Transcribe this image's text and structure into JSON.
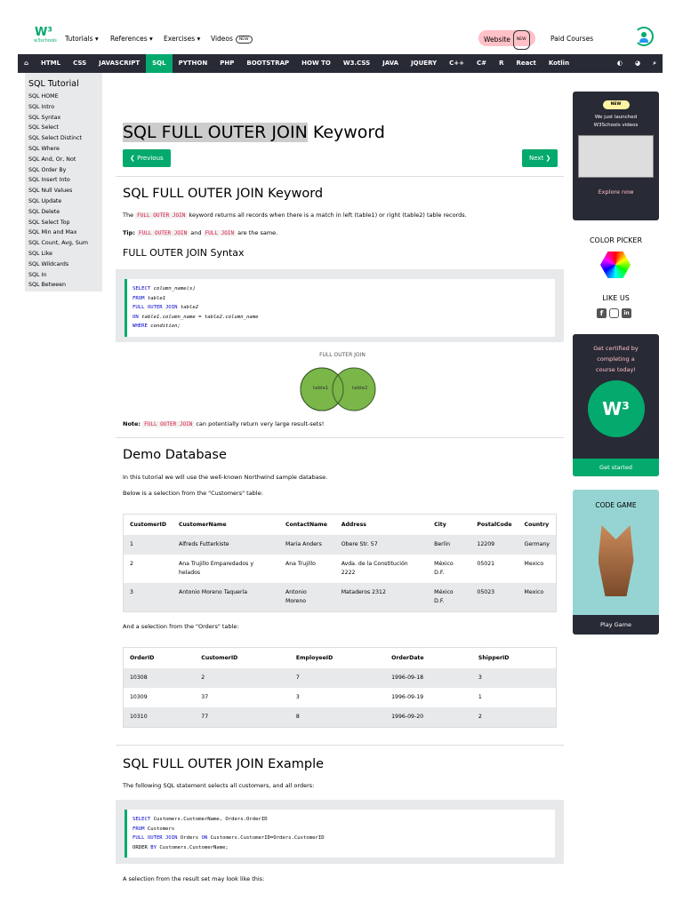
{
  "header": {
    "logo": "w3schools",
    "menu": [
      "Tutorials ▾",
      "References ▾",
      "Exercises ▾",
      "Videos"
    ],
    "new_badge": "NEW",
    "website": "Website",
    "paid_courses": "Paid Courses"
  },
  "nav": {
    "items": [
      "HTML",
      "CSS",
      "JAVASCRIPT",
      "SQL",
      "PYTHON",
      "PHP",
      "BOOTSTRAP",
      "HOW TO",
      "W3.CSS",
      "JAVA",
      "JQUERY",
      "C++",
      "C#",
      "R",
      "React",
      "Kotlin"
    ],
    "active": "SQL"
  },
  "left_sidebar": {
    "title": "SQL Tutorial",
    "items": [
      "SQL HOME",
      "SQL Intro",
      "SQL Syntax",
      "SQL Select",
      "SQL Select Distinct",
      "SQL Where",
      "SQL And, Or, Not",
      "SQL Order By",
      "SQL Insert Into",
      "SQL Null Values",
      "SQL Update",
      "SQL Delete",
      "SQL Select Top",
      "SQL Min and Max",
      "SQL Count, Avg, Sum",
      "SQL Like",
      "SQL Wildcards",
      "SQL In",
      "SQL Between"
    ]
  },
  "main": {
    "title_hl": "SQL FULL OUTER JOIN",
    "title_rest": " Keyword",
    "prev": "❮ Previous",
    "next": "Next ❯",
    "h2": "SQL FULL OUTER JOIN Keyword",
    "p1_a": "The ",
    "p1_kw": "FULL OUTER JOIN",
    "p1_b": " keyword returns all records when there is a match in left (table1) or right (table2) table records.",
    "tip_label": "Tip:",
    "tip_kw1": "FULL OUTER JOIN",
    "tip_and": " and ",
    "tip_kw2": "FULL JOIN",
    "tip_end": " are the same.",
    "syntax_h": "FULL OUTER JOIN Syntax",
    "syntax": [
      [
        "SELECT",
        " column_name(s)"
      ],
      [
        "FROM",
        " table1"
      ],
      [
        "FULL OUTER JOIN",
        " table2"
      ],
      [
        "ON",
        " table1.column_name = table2.column_name"
      ],
      [
        "WHERE",
        " condition;"
      ]
    ],
    "venn": {
      "title": "FULL OUTER JOIN",
      "left": "table1",
      "right": "table2"
    },
    "note_label": "Note:",
    "note_kw": "FULL OUTER JOIN",
    "note_text": " can potentially return very large result-sets!",
    "demo_h": "Demo Database",
    "demo_p1": "In this tutorial we will use the well-known Northwind sample database.",
    "demo_p2": "Below is a selection from the \"Customers\" table:",
    "customers": {
      "headers": [
        "CustomerID",
        "CustomerName",
        "ContactName",
        "Address",
        "City",
        "PostalCode",
        "Country"
      ],
      "rows": [
        [
          "1",
          "Alfreds Futterkiste",
          "Maria Anders",
          "Obere Str. 57",
          "Berlin",
          "12209",
          "Germany"
        ],
        [
          "2",
          "Ana Trujillo Emparedados y helados",
          "Ana Trujillo",
          "Avda. de la Constitución 2222",
          "México D.F.",
          "05021",
          "Mexico"
        ],
        [
          "3",
          "Antonio Moreno Taquería",
          "Antonio Moreno",
          "Mataderos 2312",
          "México D.F.",
          "05023",
          "Mexico"
        ]
      ]
    },
    "orders_p": "And a selection from the \"Orders\" table:",
    "orders": {
      "headers": [
        "OrderID",
        "CustomerID",
        "EmployeeID",
        "OrderDate",
        "ShipperID"
      ],
      "rows": [
        [
          "10308",
          "2",
          "7",
          "1996-09-18",
          "3"
        ],
        [
          "10309",
          "37",
          "3",
          "1996-09-19",
          "1"
        ],
        [
          "10310",
          "77",
          "8",
          "1996-09-20",
          "2"
        ]
      ]
    },
    "example_h": "SQL FULL OUTER JOIN Example",
    "example_p": "The following SQL statement selects all customers, and all orders:",
    "example_code": [
      [
        "SELECT",
        " Customers.CustomerName, Orders.OrderID"
      ],
      [
        "FROM",
        " Customers"
      ],
      [
        "FULL OUTER JOIN",
        " Orders ",
        "ON",
        " Customers.CustomerID=Orders.CustomerID"
      ],
      [
        "ORDER ",
        "BY",
        " Customers.CustomerName;"
      ]
    ],
    "result_p": "A selection from the result set may look like this:"
  },
  "right_sidebar": {
    "new": "NEW",
    "videos_text": "We just launched W3Schools videos",
    "explore": "Explore now",
    "color_picker": "COLOR PICKER",
    "like_us": "LIKE US",
    "cert_text": "Get certified by completing a course today!",
    "get_started": "Get started",
    "code_game": "CODE GAME",
    "play_game": "Play Game"
  },
  "colors": {
    "accent": "#04AA6D",
    "nav": "#282A35",
    "keyword": "#DC143C"
  }
}
